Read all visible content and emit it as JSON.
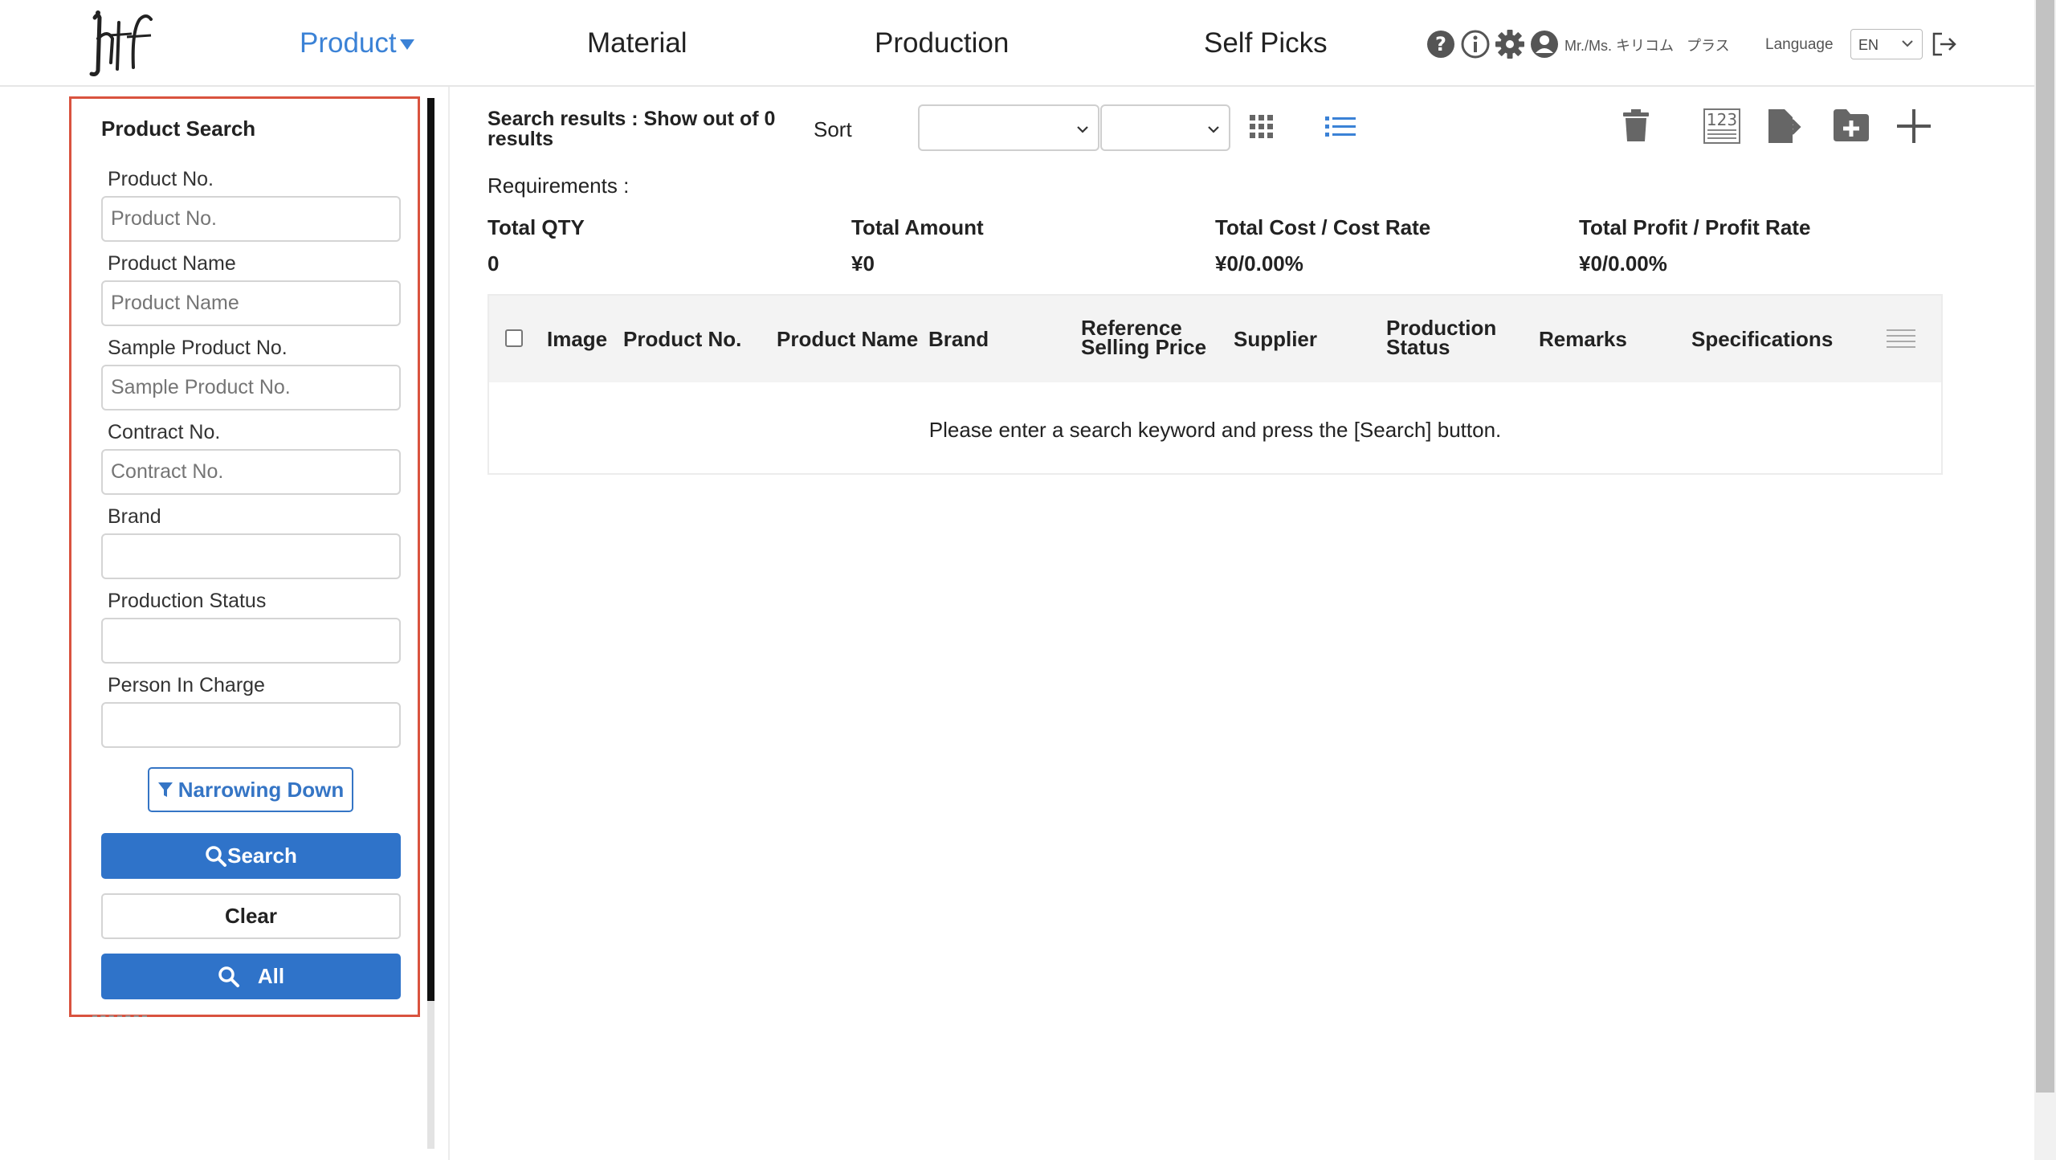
{
  "nav": {
    "items": [
      {
        "label": "Product",
        "active": true
      },
      {
        "label": "Material",
        "active": false
      },
      {
        "label": "Production",
        "active": false
      },
      {
        "label": "Self Picks",
        "active": false
      }
    ],
    "user_name": "Mr./Ms. キリコム",
    "user_kana": "プラス",
    "language_label": "Language",
    "language_value": "EN",
    "icons": [
      "help-icon",
      "info-icon",
      "settings-gear-icon",
      "user-account-icon",
      "logout-icon"
    ]
  },
  "sidebar": {
    "title": "Product Search",
    "fields": [
      {
        "label": "Product No.",
        "placeholder": "Product No."
      },
      {
        "label": "Product Name",
        "placeholder": "Product Name"
      },
      {
        "label": "Sample Product No.",
        "placeholder": "Sample Product No."
      },
      {
        "label": "Contract No.",
        "placeholder": "Contract No."
      },
      {
        "label": "Brand",
        "placeholder": ""
      },
      {
        "label": "Production Status",
        "placeholder": ""
      },
      {
        "label": "Person In Charge",
        "placeholder": ""
      }
    ],
    "narrow_label": "Narrowing Down",
    "search_label": "Search",
    "clear_label": "Clear",
    "all_label": "All",
    "highlight_color": "#d9533f"
  },
  "main": {
    "results_text": "Search results : Show out of 0 results",
    "sort_label": "Sort",
    "sort_field_value": "",
    "sort_order_value": "",
    "requirements_label": "Requirements :",
    "summary": [
      {
        "label": "Total QTY",
        "value": "0"
      },
      {
        "label": "Total Amount",
        "value": "¥0"
      },
      {
        "label": "Total Cost / Cost Rate",
        "value": "¥0/0.00%"
      },
      {
        "label": "Total Profit / Profit Rate",
        "value": "¥0/0.00%"
      }
    ],
    "toolbar_icons": [
      "grid-view-icon",
      "list-view-icon",
      "trash-icon",
      "number-label-icon",
      "export-file-icon",
      "add-folder-icon",
      "plus-icon"
    ],
    "table": {
      "columns": [
        "Image",
        "Product No.",
        "Product Name",
        "Brand",
        "Reference Selling Price",
        "Supplier",
        "Production Status",
        "Remarks",
        "Specifications"
      ],
      "empty_message": "Please enter a search keyword and press the [Search] button."
    }
  },
  "colors": {
    "accent": "#3b82d6",
    "button": "#2f73c9"
  }
}
